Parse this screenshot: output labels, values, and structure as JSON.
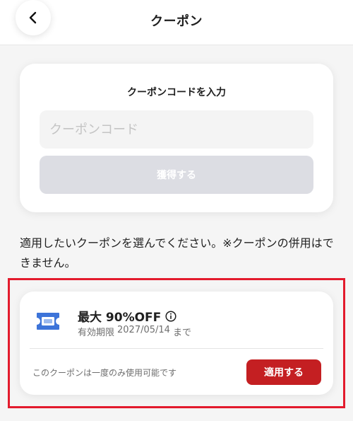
{
  "header": {
    "title": "クーポン",
    "back_icon": "chevron-left-icon"
  },
  "code_entry": {
    "title": "クーポンコードを入力",
    "input_placeholder": "クーポンコード",
    "input_value": "",
    "submit_label": "獲得する"
  },
  "instruction": "適用したいクーポンを選んでください。※クーポンの併用はできません。",
  "coupon": {
    "title": "最大 90%OFF",
    "info_icon": "info-icon",
    "ticket_icon": "ticket-icon",
    "validity_label": "有効期限",
    "validity_date": "2027/05/14",
    "validity_suffix": "まで",
    "note": "このクーポンは一度のみ使用可能です",
    "apply_label": "適用する"
  },
  "colors": {
    "accent_red": "#c41f22",
    "highlight_border": "#e31b2d",
    "ticket_blue": "#3d74d9",
    "disabled_button": "#dcdde3"
  }
}
